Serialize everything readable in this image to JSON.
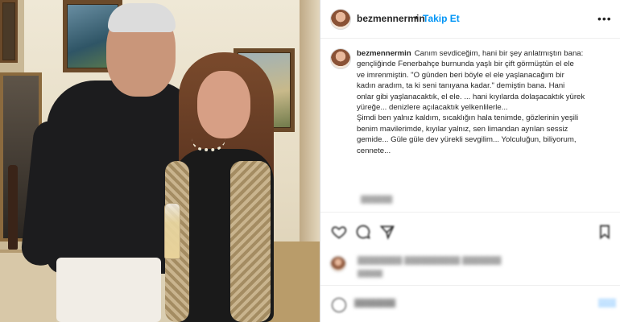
{
  "post": {
    "username": "bezmennermin",
    "follow_label": "Takip Et",
    "separator": "•",
    "more_icon": "more-horizontal-icon"
  },
  "caption": {
    "username": "bezmennermin",
    "lines": [
      "Canım sevdiceğim, hani bir şey anlatmıştın bana:",
      "gençliğinde Fenerbahçe burnunda yaşlı bir çift görmüştün el ele",
      "ve imrenmiştin. \"O günden beri böyle el ele yaşlanacağım bir",
      "kadın aradım, ta ki seni tanıyana kadar.\" demiştin bana. Hani",
      "onlar gibi yaşlanacaktık, el ele. ... hani kıyılarda dolaşacaktık yürek",
      "yüreğe... denizlere açılacaktık yelkenlilerle...",
      "Şimdi ben yalnız kaldım, sıcaklığın hala tenimde, gözlerinin yeşili",
      "benim mavilerimde, kıyılar yalnız, sen limandan ayrılan sessiz",
      "gemide... Güle güle dev yürekli sevgilim... Yolculuğun, biliyorum,",
      "cennete..."
    ],
    "time_ago": "▓▓▓▓▓▓"
  },
  "actions": {
    "icons": [
      "heart-icon",
      "comment-icon",
      "share-icon",
      "bookmark-icon"
    ]
  },
  "likes": {
    "text": "▓▓▓▓▓▓▓▓ ▓▓▓▓▓▓▓▓▓▓ ▓▓▓▓▓▓▓",
    "date": "▓▓▓▓▓"
  },
  "comment_box": {
    "placeholder": "▓▓▓▓▓▓▓",
    "post_label": "▓▓▓"
  },
  "colors": {
    "link_blue": "#0095f6",
    "text": "#262626",
    "border": "#dbdbdb"
  }
}
